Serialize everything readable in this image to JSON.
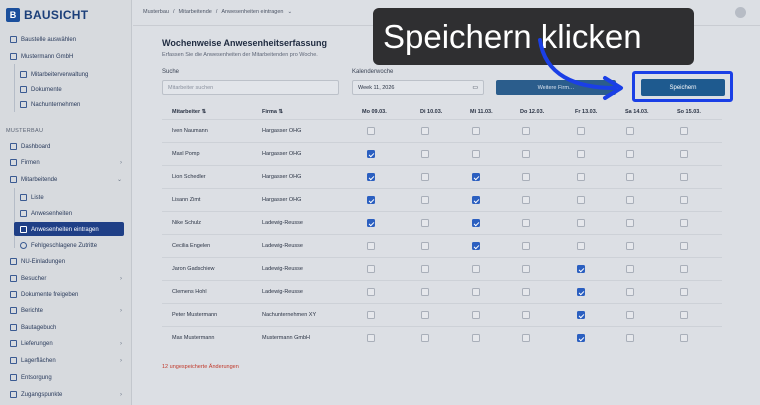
{
  "brand": {
    "name": "BAUSICHT",
    "mark": "B"
  },
  "sidebar": {
    "top_items": [
      {
        "label": "Baustelle auswählen",
        "icon": "building-icon"
      },
      {
        "label": "Mustermann GmbH",
        "icon": "company-icon"
      },
      {
        "label": "Mitarbeiterverwaltung",
        "icon": "users-icon"
      },
      {
        "label": "Dokumente",
        "icon": "document-icon"
      },
      {
        "label": "Nachunternehmen",
        "icon": "contractor-icon"
      }
    ],
    "section_label": "MUSTERBAU",
    "items": [
      {
        "label": "Dashboard",
        "icon": "dashboard-icon"
      },
      {
        "label": "Firmen",
        "icon": "company-icon",
        "chevron": "›"
      },
      {
        "label": "Mitarbeitende",
        "icon": "users-icon",
        "chevron": "⌄"
      },
      {
        "label": "Liste",
        "icon": "list-icon"
      },
      {
        "label": "Anwesenheiten",
        "icon": "clock-icon"
      },
      {
        "label": "Anwesenheiten eintragen",
        "icon": "calendar-icon"
      },
      {
        "label": "Fehlgeschlagene Zutritte",
        "icon": "blocked-icon"
      },
      {
        "label": "NU-Einladungen",
        "icon": "mail-icon"
      },
      {
        "label": "Besucher",
        "icon": "visitor-icon",
        "chevron": "›"
      },
      {
        "label": "Dokumente freigeben",
        "icon": "document-check-icon"
      },
      {
        "label": "Berichte",
        "icon": "report-icon",
        "chevron": "›"
      },
      {
        "label": "Bautagebuch",
        "icon": "book-icon"
      },
      {
        "label": "Lieferungen",
        "icon": "truck-icon",
        "chevron": "›"
      },
      {
        "label": "Lagerflächen",
        "icon": "storage-icon",
        "chevron": "›"
      },
      {
        "label": "Entsorgung",
        "icon": "recycle-icon"
      },
      {
        "label": "Zugangspunkte",
        "icon": "door-icon",
        "chevron": "›"
      }
    ]
  },
  "header": {
    "breadcrumbs": [
      "Musterbau",
      "/",
      "Mitarbeitende",
      "/",
      "Anwesenheiten eintragen",
      "⌄"
    ]
  },
  "page": {
    "title": "Wochenweise Anwesenheitserfassung",
    "subtitle": "Erfassen Sie die Anwesenheiten der Mitarbeitenden pro Woche.",
    "search_label": "Suche",
    "search_placeholder": "Mitarbeiter suchen",
    "week_label": "Kalenderwoche",
    "week_value": "Week 11, 2026",
    "secondary_button": "Weitere Firm…",
    "save_button": "Speichern",
    "unsaved_text": "12 ungespeicherte Änderungen"
  },
  "table": {
    "columns": [
      "Mitarbeiter",
      "Firma",
      "Mo 09.03.",
      "Di 10.03.",
      "Mi 11.03.",
      "Do 12.03.",
      "Fr 13.03.",
      "Sa 14.03.",
      "So 15.03."
    ],
    "rows": [
      {
        "name": "Iven Naumann",
        "company": "Hargasser OHG",
        "days": [
          false,
          false,
          false,
          false,
          false,
          false,
          false
        ]
      },
      {
        "name": "Maxl Pomp",
        "company": "Hargasser OHG",
        "days": [
          true,
          false,
          false,
          false,
          false,
          false,
          false
        ]
      },
      {
        "name": "Lion Schedler",
        "company": "Hargasser OHG",
        "days": [
          true,
          false,
          true,
          false,
          false,
          false,
          false
        ]
      },
      {
        "name": "Lisann Zimt",
        "company": "Hargasser OHG",
        "days": [
          true,
          false,
          true,
          false,
          false,
          false,
          false
        ]
      },
      {
        "name": "Nike Schulz",
        "company": "Ladewig-Reusse",
        "days": [
          true,
          false,
          true,
          false,
          false,
          false,
          false
        ]
      },
      {
        "name": "Cecilia Engelen",
        "company": "Ladewig-Reusse",
        "days": [
          false,
          false,
          true,
          false,
          false,
          false,
          false
        ]
      },
      {
        "name": "Jaron Gadschiew",
        "company": "Ladewig-Reusse",
        "days": [
          false,
          false,
          false,
          false,
          true,
          false,
          false
        ]
      },
      {
        "name": "Clemens Hohl",
        "company": "Ladewig-Reusse",
        "days": [
          false,
          false,
          false,
          false,
          true,
          false,
          false
        ]
      },
      {
        "name": "Peter Mustermann",
        "company": "Nachunternehmen XY",
        "days": [
          false,
          false,
          false,
          false,
          true,
          false,
          false
        ]
      },
      {
        "name": "Max Mustermann",
        "company": "Mustermann GmbH",
        "days": [
          false,
          false,
          false,
          false,
          true,
          false,
          false
        ]
      }
    ]
  },
  "overlay": {
    "tooltip_text": "Speichern klicken",
    "highlight_color": "#1a3fe6"
  }
}
